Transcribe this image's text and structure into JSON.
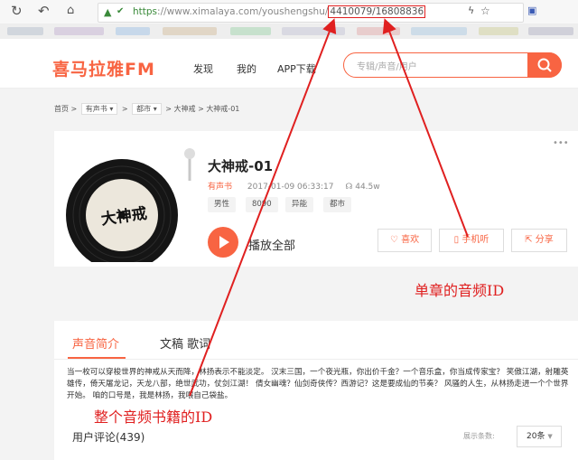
{
  "browser": {
    "url_scheme": "https",
    "url_host": "://www.ximalaya.com/youshengshu/",
    "url_ids": "4410079/16808836",
    "star_icon": "star-icon"
  },
  "site": {
    "logo": "喜马拉雅FM",
    "nav": [
      "发现",
      "我的",
      "APP下载"
    ],
    "search_placeholder": "专辑/声音/用户"
  },
  "breadcrumb": {
    "home": "首页",
    "sep": ">",
    "category": "有声书",
    "subcategory": "都市",
    "album": "大神戒",
    "track": "大神戒-01"
  },
  "track": {
    "title": "大神戒-01",
    "category": "有声书",
    "date": "2017-01-09 06:33:17",
    "plays": "44.5w",
    "tags": [
      "男性",
      "8090",
      "异能",
      "都市"
    ],
    "cover_title": "大神戒",
    "play_all": "播放全部",
    "actions": [
      "喜欢",
      "手机听",
      "分享"
    ]
  },
  "intro": {
    "tabs": [
      "声音简介",
      "文稿 歌词"
    ],
    "text": "当一枚可以穿梭世界的神戒从天而降，林扬表示不能淡定。 汉末三国，一个夜光瓶，你出价千金？一个音乐盒，你当成传家宝？ 笑傲江湖，射雕英雄传，倚天屠龙记，天龙八部，绝世武功，仗剑江湖！ 倩女幽魂？仙剑奇侠传？西游记？这是要成仙的节奏？ 风骚的人生，从林扬走进一个个世界开始。 咱的口号是，我是林扬，我喂自己袋盐。",
    "comments_label": "用户评论(439)",
    "per_page_label": "展示条数:",
    "per_page_value": "20条"
  },
  "annotations": {
    "track_id_note": "单章的音频ID",
    "album_id_note": "整个音频书籍的ID"
  },
  "colors": {
    "brand": "#f86442",
    "annotation": "#e02020"
  }
}
